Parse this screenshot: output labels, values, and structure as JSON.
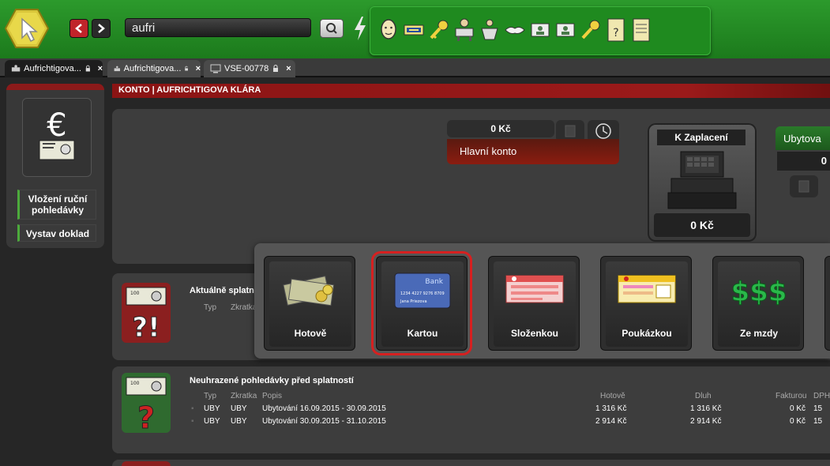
{
  "toolbar": {
    "search_value": "aufri"
  },
  "tabs": [
    {
      "label": "Aufrichtigova..."
    },
    {
      "label": "Aufrichtigova..."
    },
    {
      "label": "VSE-00778"
    }
  ],
  "left": {
    "btn_manual": "Vložení ruční pohledávky",
    "btn_doc": "Vystav doklad"
  },
  "header": {
    "title": "KONTO | AUFRICHTIGOVA KLÁRA"
  },
  "account": {
    "balance": "0 Kč",
    "main_account": "Hlavní konto",
    "to_pay_label": "K Zaplacení",
    "to_pay_amount": "0 Kč",
    "accommodation_label": "Ubytova",
    "accommodation_amount": "0"
  },
  "section_due": {
    "title": "Aktuálně splatn",
    "col_type": "Typ",
    "col_abbr": "Zkratka"
  },
  "section_unpaid": {
    "title": "Neuhrazené pohledávky před splatností",
    "columns": {
      "type": "Typ",
      "abbr": "Zkratka",
      "desc": "Popis",
      "cash": "Hotově",
      "debt": "Dluh",
      "invoice": "Fakturou",
      "vat": "DPH"
    },
    "rows": [
      {
        "type": "UBY",
        "abbr": "UBY",
        "desc": "Ubytování 16.09.2015 - 30.09.2015",
        "cash": "1 316 Kč",
        "debt": "1 316 Kč",
        "invoice": "0 Kč",
        "vat": "15"
      },
      {
        "type": "UBY",
        "abbr": "UBY",
        "desc": "Ubytování 30.09.2015 - 31.10.2015",
        "cash": "2 914 Kč",
        "debt": "2 914 Kč",
        "invoice": "0 Kč",
        "vat": "15"
      }
    ]
  },
  "payment_methods": [
    {
      "label": "Hotově",
      "icon": "cash-icon"
    },
    {
      "label": "Kartou",
      "icon": "card-icon",
      "selected": true
    },
    {
      "label": "Složenkou",
      "icon": "postal-slip-icon"
    },
    {
      "label": "Poukázkou",
      "icon": "voucher-icon"
    },
    {
      "label": "Ze mzdy",
      "icon": "salary-icon"
    }
  ],
  "card_text": {
    "bank": "Bank",
    "number": "1234 4227 9276 8709",
    "holder": "Jana Priezova"
  },
  "colors": {
    "accent_green": "#1f8a1f",
    "header_red": "#8b1414",
    "selected_outline": "#d62020"
  }
}
